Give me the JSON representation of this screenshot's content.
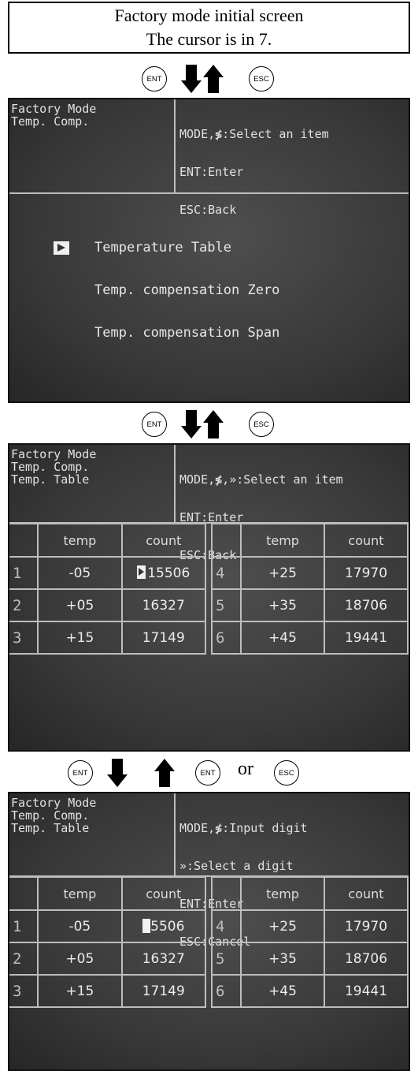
{
  "caption": {
    "line1": "Factory mode initial screen",
    "line2": "The cursor is in 7."
  },
  "keys": {
    "ent": "ENT",
    "esc": "ESC",
    "or": "or"
  },
  "screen1": {
    "header_left": [
      "Factory Mode",
      "Temp. Comp."
    ],
    "header_right": [
      "MODE,≸:Select an item",
      "ENT:Enter",
      "ESC:Back"
    ],
    "menu": [
      "Temperature Table",
      "Temp. compensation Zero",
      "Temp. compensation Span"
    ]
  },
  "screen2": {
    "header_left": [
      "Factory Mode",
      "Temp. Comp.",
      "Temp. Table"
    ],
    "header_right": [
      "MODE,≸,»:Select an item",
      "ENT:Enter",
      "ESC:Back"
    ]
  },
  "screen3": {
    "header_left": [
      "Factory Mode",
      "Temp. Comp.",
      "Temp. Table"
    ],
    "header_right": [
      "MODE,≸:Input digit",
      "»:Select a digit",
      "ENT:Enter",
      "ESC:Cancel"
    ],
    "first_count_rest": "5506"
  },
  "table": {
    "col_temp": "temp",
    "col_count": "count",
    "left_rows": [
      {
        "num": "1",
        "temp": "-05",
        "count": "15506"
      },
      {
        "num": "2",
        "temp": "+05",
        "count": "16327"
      },
      {
        "num": "3",
        "temp": "+15",
        "count": "17149"
      }
    ],
    "right_rows": [
      {
        "num": "4",
        "temp": "+25",
        "count": "17970"
      },
      {
        "num": "5",
        "temp": "+35",
        "count": "18706"
      },
      {
        "num": "6",
        "temp": "+45",
        "count": "19441"
      }
    ]
  }
}
